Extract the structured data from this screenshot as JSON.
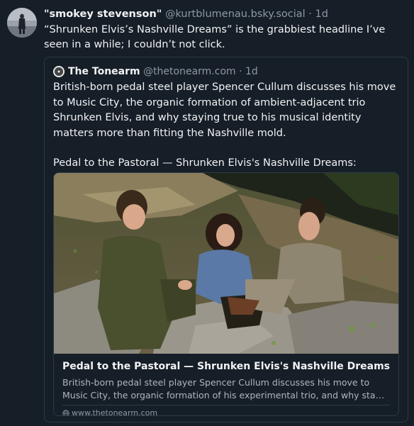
{
  "post": {
    "display_name": "\"smokey stevenson\"",
    "handle": "@kurtblumenau.bsky.social",
    "separator": "·",
    "time": "1d",
    "text": "“Shrunken Elvis’s Nashville Dreams” is the grabbiest headline I’ve seen in a while; I couldn’t not click."
  },
  "quote": {
    "display_name": "The Tonearm",
    "handle": "@thetonearm.com",
    "separator": "·",
    "time": "1d",
    "paragraph1": "British-born pedal steel player Spencer Cullum discusses his move to Music City, the organic formation of ambient-adjacent trio Shrunken Elvis, and why staying true to his musical identity matters more than fitting the Nashville mold.",
    "paragraph2": "Pedal to the Pastoral — Shrunken Elvis's Nashville Dreams:"
  },
  "link_card": {
    "title": "Pedal to the Pastoral — Shrunken Elvis's Nashville Dreams",
    "description_line1": "British-born pedal steel player Spencer Cullum discusses his move to",
    "description_line2": "Music City, the organic formation of his experimental trio, and why stayi...",
    "domain": "www.thetonearm.com",
    "domain_icon": "globe-icon"
  },
  "colors": {
    "background": "#161e27",
    "border": "#2e3a47",
    "muted_text": "#8d98a5"
  }
}
